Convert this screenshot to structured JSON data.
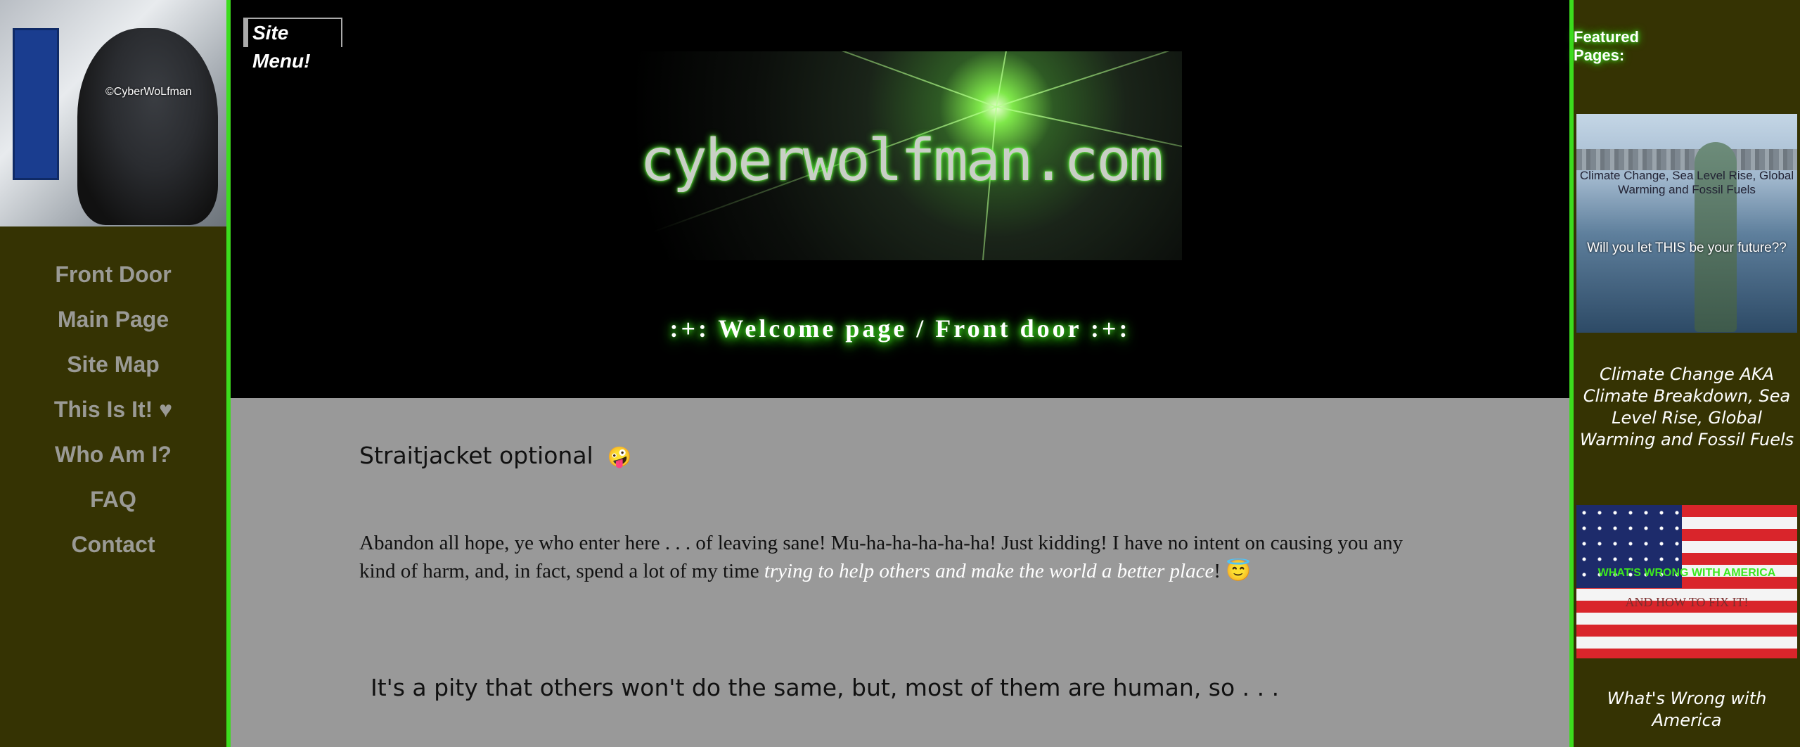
{
  "avatar": {
    "watermark": "©CyberWoLfman"
  },
  "nav": {
    "items": [
      {
        "label": "Front Door"
      },
      {
        "label": "Main Page"
      },
      {
        "label": "Site Map"
      },
      {
        "label": "This Is It!  ♥"
      },
      {
        "label": "Who Am I?"
      },
      {
        "label": "FAQ"
      },
      {
        "label": "Contact"
      }
    ]
  },
  "header": {
    "site_menu": "Site Menu!",
    "banner_text": "cyberwolfman.com",
    "welcome": ":+:  Welcome page / Front door  :+:"
  },
  "content": {
    "heading1": "Straitjacket optional",
    "heading1_emoji": "🤪",
    "para1_text": "  Abandon all hope, ye who enter here . . .  of leaving sane!  Mu-ha-ha-ha-ha-ha!  Just kidding!  I have no intent on causing you any kind of harm, and, in fact, spend a lot of my time ",
    "para1_italic": "trying to help others and make the world a better place",
    "para1_end": "!  ",
    "para1_emoji": "😇",
    "para2": "It's a pity that others won't do the same, but, most of them are human, so . . ."
  },
  "featured": {
    "title": "Featured Pages:",
    "items": [
      {
        "image_title": "Climate Change, Sea Level Rise, Global Warming and Fossil Fuels",
        "image_question": "Will you let THIS be your future??",
        "caption": "Climate Change AKA Climate Breakdown, Sea Level Rise, Global Warming and Fossil Fuels"
      },
      {
        "image_title": "WHAT'S WRONG WITH AMERICA",
        "image_subtitle": "AND HOW TO FIX IT!",
        "caption": "What's Wrong with America"
      }
    ]
  },
  "colors": {
    "accent": "#3cdc1e",
    "sidebar_bg": "#353303",
    "content_bg": "#999999",
    "nav_text": "#9a9a95"
  }
}
